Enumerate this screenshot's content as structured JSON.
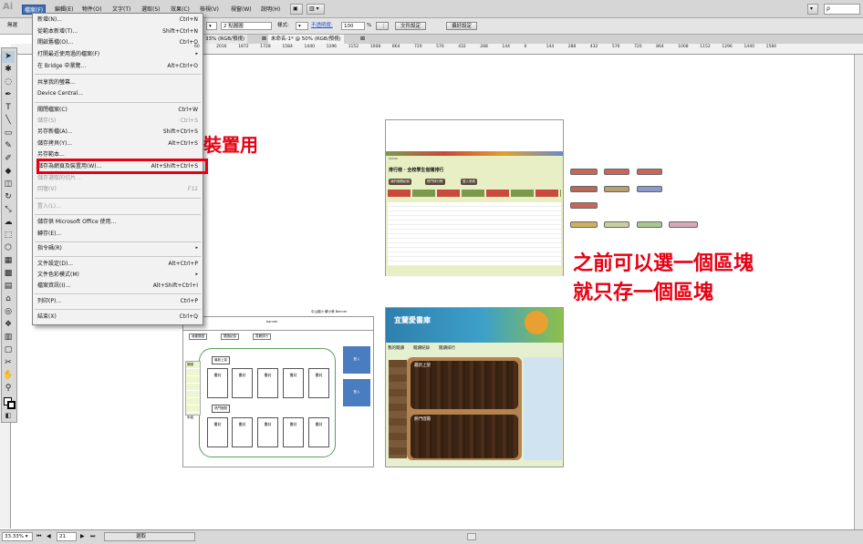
{
  "app": {
    "logo": "Ai"
  },
  "menubar": {
    "items": [
      "檔案(F)",
      "編輯(E)",
      "物件(O)",
      "文字(T)",
      "選取(S)",
      "效果(C)",
      "檢視(V)",
      "視窗(W)",
      "說明(H)"
    ],
    "buttons": [
      "▣",
      "▥ ▾"
    ],
    "search_placeholder": "ρ"
  },
  "control_bar": {
    "left_label": "無選",
    "stroke": "2 點圓圓",
    "style_label": "樣式:",
    "opacity_label": "不透明度:",
    "opacity_value": "100",
    "percent": "%",
    "doc_setup": "文件設定",
    "preferences": "偏好設定"
  },
  "tabs": [
    "33% (RGB/預視)",
    "未命名-1* @ 50% (RGB/預視)"
  ],
  "ruler_ticks": [
    "60",
    "2016",
    "1872",
    "1728",
    "1584",
    "1440",
    "1296",
    "1152",
    "1008",
    "864",
    "720",
    "576",
    "432",
    "288",
    "144",
    "0",
    "144",
    "288",
    "432",
    "576",
    "720",
    "864",
    "1008",
    "1152",
    "1296",
    "1440",
    "1584"
  ],
  "file_menu": {
    "items": [
      {
        "label": "新增(N)...",
        "shortcut": "Ctrl+N"
      },
      {
        "label": "從範本新增(T)...",
        "shortcut": "Shift+Ctrl+N"
      },
      {
        "label": "開啟舊檔(O)...",
        "shortcut": "Ctrl+O"
      },
      {
        "label": "打開最近使用過的檔案(F)",
        "shortcut": "▸"
      },
      {
        "label": "在 Bridge 中瀏覽...",
        "shortcut": "Alt+Ctrl+O"
      },
      {
        "label": "共享我的螢幕...",
        "shortcut": ""
      },
      {
        "label": "Device Central...",
        "shortcut": ""
      },
      {
        "label": "關閉檔案(C)",
        "shortcut": "Ctrl+W"
      },
      {
        "label": "儲存(S)",
        "shortcut": "Ctrl+S"
      },
      {
        "label": "另存新檔(A)...",
        "shortcut": "Shift+Ctrl+S"
      },
      {
        "label": "儲存拷貝(Y)...",
        "shortcut": "Alt+Ctrl+S"
      },
      {
        "label": "另存範本...",
        "shortcut": ""
      },
      {
        "label": "儲存為網頁及裝置用(W)...",
        "shortcut": "Alt+Shift+Ctrl+S"
      },
      {
        "label": "儲存選取的切片...",
        "shortcut": ""
      },
      {
        "label": "回復(V)",
        "shortcut": "F12"
      },
      {
        "label": "置入(L)...",
        "shortcut": ""
      },
      {
        "label": "儲存供 Microsoft Office 使用...",
        "shortcut": ""
      },
      {
        "label": "轉存(E)...",
        "shortcut": ""
      },
      {
        "label": "指令碼(R)",
        "shortcut": "▸"
      },
      {
        "label": "文件設定(D)...",
        "shortcut": "Alt+Ctrl+P"
      },
      {
        "label": "文件色彩模式(M)",
        "shortcut": "▸"
      },
      {
        "label": "檔案資訊(I)...",
        "shortcut": "Alt+Shift+Ctrl+I"
      },
      {
        "label": "列印(P)...",
        "shortcut": "Ctrl+P"
      },
      {
        "label": "結束(X)",
        "shortcut": "Ctrl+Q"
      }
    ]
  },
  "annotations": {
    "callout_main": "儲存為網頁及裝置用",
    "note_line1": "之前可以選一個區塊",
    "note_line2": "就只存一個區塊"
  },
  "artboard_wire": {
    "header": "中山國小  蘇小美    Banner",
    "banner": "banner",
    "nav": [
      "我要閱讀",
      "閱讀紀錄",
      "書籍排行"
    ],
    "left_labels": [
      "閱讀",
      "年級"
    ],
    "sections": [
      "最新上架",
      "熱門借閱"
    ],
    "book_label": "書封",
    "side_label": "登入"
  },
  "artboard_rank": {
    "title": "排行榜 · 全校學生借閱排行",
    "buttons": [
      "我的借閱紀錄",
      "熱門排行榜",
      "登入系統"
    ]
  },
  "artboard_home": {
    "title": "宜蘭愛書庫",
    "nav": [
      "我的閱讀",
      "閱讀紀錄",
      "閱讀排行"
    ],
    "panel1": "最新上架",
    "panel2": "熱門借閱"
  },
  "statusbar": {
    "zoom": "33.33%",
    "page": "21",
    "mode": "選取"
  },
  "colors": {
    "accent": "#e60012",
    "menu_active": "#3d6eb4"
  }
}
